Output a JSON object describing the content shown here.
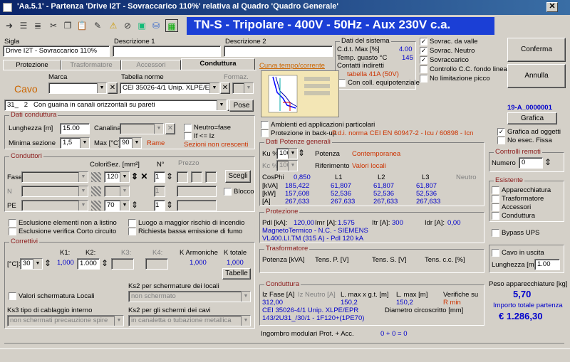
{
  "window": {
    "title": "'Aa.5.1' - Partenza 'Drive I2T - Sovraccarico 110%' relativa al Quadro 'Quadro Generale'",
    "close": "✕"
  },
  "banner": "TN-S - Tripolare - 400V - 50Hz - Aux 230V c.a.",
  "header": {
    "sigla_label": "Sigla",
    "sigla_value": "Drive I2T - Sovraccarico 110%",
    "desc1_label": "Descrizione 1",
    "desc2_label": "Descrizione 2"
  },
  "dati_sistema": {
    "title": "Dati del sistema",
    "cdt_label": "C.d.t. Max [%]",
    "cdt_value": "4.00",
    "temp_label": "Temp. guasto °C",
    "temp_value": "145",
    "contatti_label": "Contatti indiretti",
    "tabella": "tabella 41A (50V)",
    "equip_label": "Con coll. equipotenziale"
  },
  "flags": {
    "items": [
      {
        "label": "Sovrac. da valle",
        "checked": "✓"
      },
      {
        "label": "Sovrac. Neutro",
        "checked": "✓"
      },
      {
        "label": "Sovraccarico",
        "checked": "✓"
      },
      {
        "label": "Controllo C.C. fondo linea",
        "checked": ""
      },
      {
        "label": "No limitazione picco",
        "checked": ""
      }
    ]
  },
  "nav": {
    "conferma": "Conferma",
    "annulla": "Annulla"
  },
  "tabs": [
    {
      "label": "Protezione"
    },
    {
      "label": "Trasformatore"
    },
    {
      "label": "Accessori"
    },
    {
      "label": "Conduttura"
    }
  ],
  "cavo": {
    "marca_label": "Marca",
    "tabella_label": "Tabella norme",
    "formaz_label": "Formaz.",
    "cavo_label": "Cavo",
    "tabella_value": "CEI 35026-4/1 Unip. XLPE/EPR",
    "posa_code": "31_",
    "posa_n": "2",
    "posa_desc": "Con guaina in canali orizzontali su pareti",
    "posa_btn": "Pose"
  },
  "curva_label": "Curva tempo/corrente",
  "dati_conduttura": {
    "title": "Dati conduttura",
    "lunghezza_label": "Lunghezza [m]",
    "lunghezza_value": "15.00",
    "canalina_label": "Canalina:",
    "neutro_fase": "Neutro=fase",
    "if_iz": "If <= Iz",
    "min_sez_label": "Minima sezione",
    "min_sez_value": "1,5",
    "max_label": "Max [°C]",
    "max_value": "90",
    "rame": "Rame",
    "sezioni": "Sezioni non crescenti"
  },
  "conduttori": {
    "title": "Conduttori",
    "colori_label": "Colori",
    "sez_label": "Sez. [mm²]",
    "n_label": "N°",
    "prezzo_label": "Prezzo",
    "fase_label": "Fase",
    "fase_sez": "120",
    "fase_n": "1",
    "n_label2": "N",
    "n_n": "1",
    "pe_label": "PE",
    "pe_sez": "70",
    "pe_n": "1",
    "scegli": "Scegli",
    "blocco": "Blocco"
  },
  "options": {
    "escl_listino": "Esclusione elementi non a listino",
    "escl_cc": "Esclusione verifica Corto circuito",
    "luogo": "Luogo a maggior rischio di incendio",
    "richiesta": "Richiesta bassa emissione di fumo"
  },
  "correttivi": {
    "title": "Correttivi",
    "k1": "K1:",
    "k2": "K2:",
    "k3": "K3:",
    "k4": "K4:",
    "karm": "K Armoniche",
    "ktot": "K totale",
    "temp_label": "[°C]:",
    "temp_value": "30",
    "k1_value": "1,000",
    "k2_value": "1.000",
    "karm_value": "1,000",
    "ktot_value": "1,000",
    "tabelle": "Tabelle",
    "ks2_locali_label": "Ks2 per schermature dei locali",
    "valori_label": "Valori schermatura Locali",
    "ks2_locali_value": "non schermato",
    "ks3_label": "Ks3 tipo di cablaggio interno",
    "ks2_cavi_label": "Ks2 per gli schermi dei cavi",
    "ks3_value": "non schermati precauzione spire",
    "ks2_cavi_value": "in canaletta o tubazione metallica"
  },
  "ambienti": {
    "ambienti": "Ambienti ed applicazioni particolari",
    "backup": "Protezione in back-up",
    "pdi": "P.d.i. norma CEI EN 60947-2 - Icu / 60898 - Icn"
  },
  "potenze": {
    "title": "Dati Potenze generali",
    "ku": "Ku %",
    "ku_value": "100",
    "potenza": "Potenza",
    "contemporanea": "Contemporanea",
    "kc": "Kc %",
    "kc_value": "100",
    "riferimento": "Riferimento",
    "valori_locali": "Valori locali",
    "cols": [
      "CosPhi",
      "L1",
      "L2",
      "L3",
      "Neutro"
    ],
    "cosphi": "0,850",
    "rows": [
      {
        "label": "[kVA]",
        "v": [
          "185,422",
          "61,807",
          "61,807",
          "61,807"
        ]
      },
      {
        "label": "[kW]",
        "v": [
          "157,608",
          "52,536",
          "52,536",
          "52,536"
        ]
      },
      {
        "label": "[A]",
        "v": [
          "267,633",
          "267,633",
          "267,633",
          "267,633"
        ]
      }
    ]
  },
  "protezione": {
    "title": "Protezione",
    "pdl": "Pdl [kA]:",
    "pdl_value": "120,00",
    "imr": "Imr [A]:",
    "imr_value": "1.575",
    "itr": "Itr [A]:",
    "itr_value": "300",
    "idr": "Idr [A]:",
    "idr_value": "0,00",
    "desc1": "MagnetoTermico - N.C. - SIEMENS",
    "desc2": "VL400.LI.TM (315 A) - Pdl 120 kA"
  },
  "trasformatore": {
    "title": "Trasformatore",
    "potenza": "Potenza [kVA]",
    "tens_p": "Tens. P. [V]",
    "tens_s": "Tens. S. [V]",
    "tens_cc": "Tens. c.c. [%]"
  },
  "conduttura": {
    "title": "Conduttura",
    "iz_fase": "Iz Fase [A]",
    "iz_neutro": "Iz Neutro [A]",
    "lmax_xgt": "L. max x g.t. [m]",
    "lmax": "L. max [m]",
    "verifiche": "Verifiche su",
    "iz_value": "312,00",
    "lmax_xgt_value": "150,2",
    "lmax_value": "150,2",
    "rmin": "R min",
    "norma": "CEI 35026-4/1 Unip. XLPE/EPR",
    "diametro": "Diametro circoscritto [mm]",
    "formula": "143/2U31_/30/1 - 1F120+(1PE70)"
  },
  "ingombro": {
    "label": "Ingombro modulari Prot. + Acc.",
    "value": "0 + 0 = 0"
  },
  "right": {
    "code": "19-A_0000001",
    "grafica": "Grafica",
    "grafica_oggetti": "Grafica ad oggetti",
    "no_esec": "No esec. Fissa",
    "controlli_title": "Controlli remoti",
    "numero_label": "Numero",
    "numero_value": "0",
    "esistente_title": "Esistente",
    "esistente_items": [
      "Apparecchiatura",
      "Trasformatore",
      "Accessori",
      "Conduttura"
    ],
    "bypass": "Bypass UPS",
    "cavo_uscita": "Cavo in uscita",
    "lunghezza_label": "Lunghezza [m]",
    "lunghezza_value": "1.00",
    "peso_label": "Peso apparecchiature [kg]",
    "peso_value": "5,70",
    "importo_label": "Importo totale partenza",
    "importo_value": "€ 1.286,30"
  }
}
